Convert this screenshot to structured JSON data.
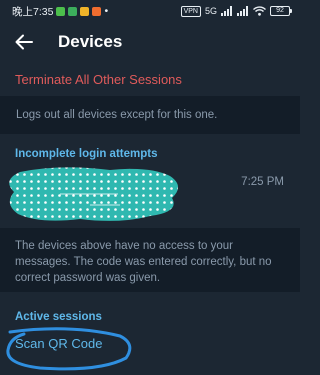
{
  "status_bar": {
    "time": "晚上7:35",
    "vpn": "VPN",
    "signal_label": "5G",
    "battery": "92"
  },
  "toolbar": {
    "back_icon": "arrow-left-icon",
    "title": "Devices"
  },
  "terminate": {
    "label": "Terminate All Other Sessions",
    "info": "Logs out all devices except for this one."
  },
  "incomplete": {
    "header": "Incomplete login attempts",
    "attempt_time": "7:25 PM",
    "info": "The devices above have no access to your messages. The code was entered correctly, but no correct password was given."
  },
  "active_sessions": {
    "header": "Active sessions",
    "scan_label": "Scan QR Code"
  },
  "colors": {
    "background": "#1c2733",
    "separator": "#131d28",
    "accent": "#5fb8ea",
    "danger": "#e05b5b",
    "secondary_text": "#8a9aab",
    "redaction": "#2fb8b0",
    "annotation": "#2f8fe0"
  }
}
